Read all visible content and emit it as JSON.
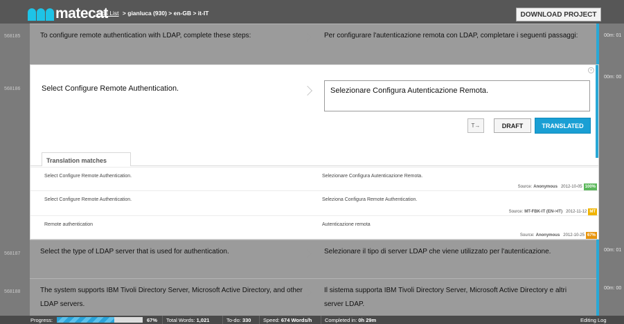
{
  "header": {
    "logo": "matecat",
    "breadcrumb_link": "Jobs List",
    "breadcrumb_rest": "> gianluca (930) > en-GB > it-IT",
    "download_label": "DOWNLOAD PROJECT"
  },
  "segments": [
    {
      "id": "568185",
      "source": "To configure remote authentication with LDAP, complete these steps:",
      "target": "Per configurare l'autenticazione remota con LDAP, completare i seguenti passaggi:",
      "time": "00m: 01"
    },
    {
      "id": "568186",
      "time": "00m: 00"
    },
    {
      "id": "568187",
      "source": "Select the type of LDAP server that is used for authentication.",
      "target": "Selezionare il tipo di server LDAP che viene utilizzato per l'autenticazione.",
      "time": "00m: 01"
    },
    {
      "id": "568188",
      "source_line1": "The system supports IBM Tivoli Directory Server, Microsoft Active Directory, and other",
      "source_line2": "LDAP servers.",
      "target_line1": "Il sistema supporta IBM Tivoli Directory Server, Microsoft Active Directory e altri",
      "target_line2": "server LDAP.",
      "time": "00m: 00"
    }
  ],
  "editor": {
    "source": "Select Configure Remote Authentication.",
    "target": "Selezionare Configura Autenticazione Remota.",
    "tag_label": "T→",
    "draft_label": "DRAFT",
    "translated_label": "TRANSLATED",
    "matches_tab": "Translation matches",
    "matches": [
      {
        "source": "Select Configure Remote Authentication.",
        "target": "Selezionare Configura Autenticazione Remota.",
        "source_prefix": "Source:",
        "origin": "Anonymous",
        "date": "2012-10-05",
        "score": "100%",
        "score_color": "#5cb85c"
      },
      {
        "source": "Select Configure Remote Authentication.",
        "target": "Seleziona Configura Remote Authentication.",
        "source_prefix": "Source:",
        "origin": "MT-FBK-IT (EN->IT)",
        "date": "2012-11-12",
        "score": "MT",
        "score_color": "#f0b400"
      },
      {
        "source": "Remote authentication",
        "target": "Autenticazione remota",
        "source_prefix": "Source:",
        "origin": "Anonymous",
        "date": "2012-10-25",
        "score": "67%",
        "score_color": "#e8940c"
      }
    ]
  },
  "footer": {
    "progress_label": "Progress:",
    "progress_value": 0.67,
    "progress_pct": "67%",
    "total_words_label": "Total Words:",
    "total_words": "1,021",
    "todo_label": "To-do:",
    "todo": "330",
    "speed_label": "Speed:",
    "speed": "674 Words/h",
    "completed_label": "Completed in:",
    "completed": "0h 29m",
    "editing_log": "Editing Log"
  }
}
